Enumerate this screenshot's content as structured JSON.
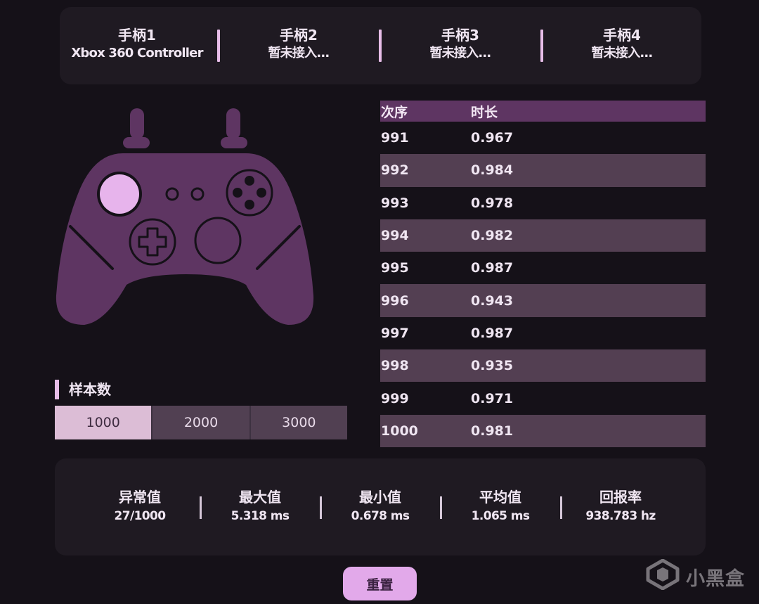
{
  "controllers": [
    {
      "name": "手柄1",
      "status": "Xbox 360 Controller"
    },
    {
      "name": "手柄2",
      "status": "暂未接入..."
    },
    {
      "name": "手柄3",
      "status": "暂未接入..."
    },
    {
      "name": "手柄4",
      "status": "暂未接入..."
    }
  ],
  "gamepad": {
    "body_color": "#5e3562",
    "accent_color": "#e7b4ec"
  },
  "sample": {
    "title": "样本数",
    "options": [
      "1000",
      "2000",
      "3000"
    ],
    "selected": "1000"
  },
  "table": {
    "headers": [
      "次序",
      "时长"
    ],
    "rows": [
      [
        "991",
        "0.967"
      ],
      [
        "992",
        "0.984"
      ],
      [
        "993",
        "0.978"
      ],
      [
        "994",
        "0.982"
      ],
      [
        "995",
        "0.987"
      ],
      [
        "996",
        "0.943"
      ],
      [
        "997",
        "0.987"
      ],
      [
        "998",
        "0.935"
      ],
      [
        "999",
        "0.971"
      ],
      [
        "1000",
        "0.981"
      ]
    ]
  },
  "stats": [
    {
      "label": "异常值",
      "value": "27/1000"
    },
    {
      "label": "最大值",
      "value": "5.318 ms"
    },
    {
      "label": "最小值",
      "value": "0.678 ms"
    },
    {
      "label": "平均值",
      "value": "1.065 ms"
    },
    {
      "label": "回报率",
      "value": "938.783 hz"
    }
  ],
  "reset_label": "重置",
  "watermark": {
    "text": "小黑盒",
    "icon": "xiaoheihe-logo-icon"
  }
}
